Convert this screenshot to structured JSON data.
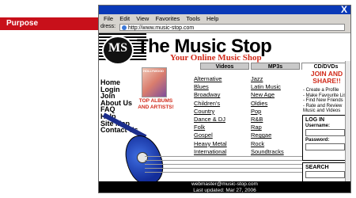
{
  "annotation": {
    "label": "Purpose"
  },
  "browser": {
    "close_icon": "X",
    "menu": [
      "File",
      "Edit",
      "View",
      "Favorites",
      "Tools",
      "Help"
    ],
    "address_label": "dress:",
    "url": "http://www.music-stop.com"
  },
  "site": {
    "logo_letters": "MS",
    "title": "The Music Stop",
    "tagline": "Your Online Music Shop"
  },
  "tabs": [
    "Videos",
    "MP3s",
    "CD/DVDs"
  ],
  "nav": [
    "Home",
    "Login",
    "Join",
    "About Us",
    "FAQ",
    "Help",
    "Site Map",
    "Contact Us"
  ],
  "featured": {
    "image_label": "HOLLYWOOD",
    "caption": "TOP ALBUMS AND ARTISTS!"
  },
  "genres": {
    "left": [
      "Alternative",
      "Blues",
      "Broadway",
      "Children's",
      "Country",
      "Dance & DJ",
      "Folk",
      "Gospel",
      "Heavy Metal",
      "International"
    ],
    "right": [
      "Jazz",
      "Latin Music",
      "New Age",
      "Oldies",
      "Pop",
      "R&B",
      "Rap",
      "Reggae",
      "Rock",
      "Soundtracks"
    ]
  },
  "join": {
    "title": "JOIN AND SHARE!!",
    "items": [
      "- Create a Profile",
      "- Make Favourite Lists",
      "- Find New Friends",
      "- Rate and Review Music and Videos"
    ]
  },
  "login": {
    "heading": "LOG IN",
    "username_label": "Username:",
    "password_label": "Password:"
  },
  "search": {
    "heading": "SEARCH"
  },
  "footer": {
    "email": "webmaster@music-stop.com",
    "updated": "Last updated: Mar 27, 2006"
  },
  "colors": {
    "accent": "#c8101a",
    "titlebar": "#0a39b7",
    "guitar": "#1b2d8c"
  }
}
